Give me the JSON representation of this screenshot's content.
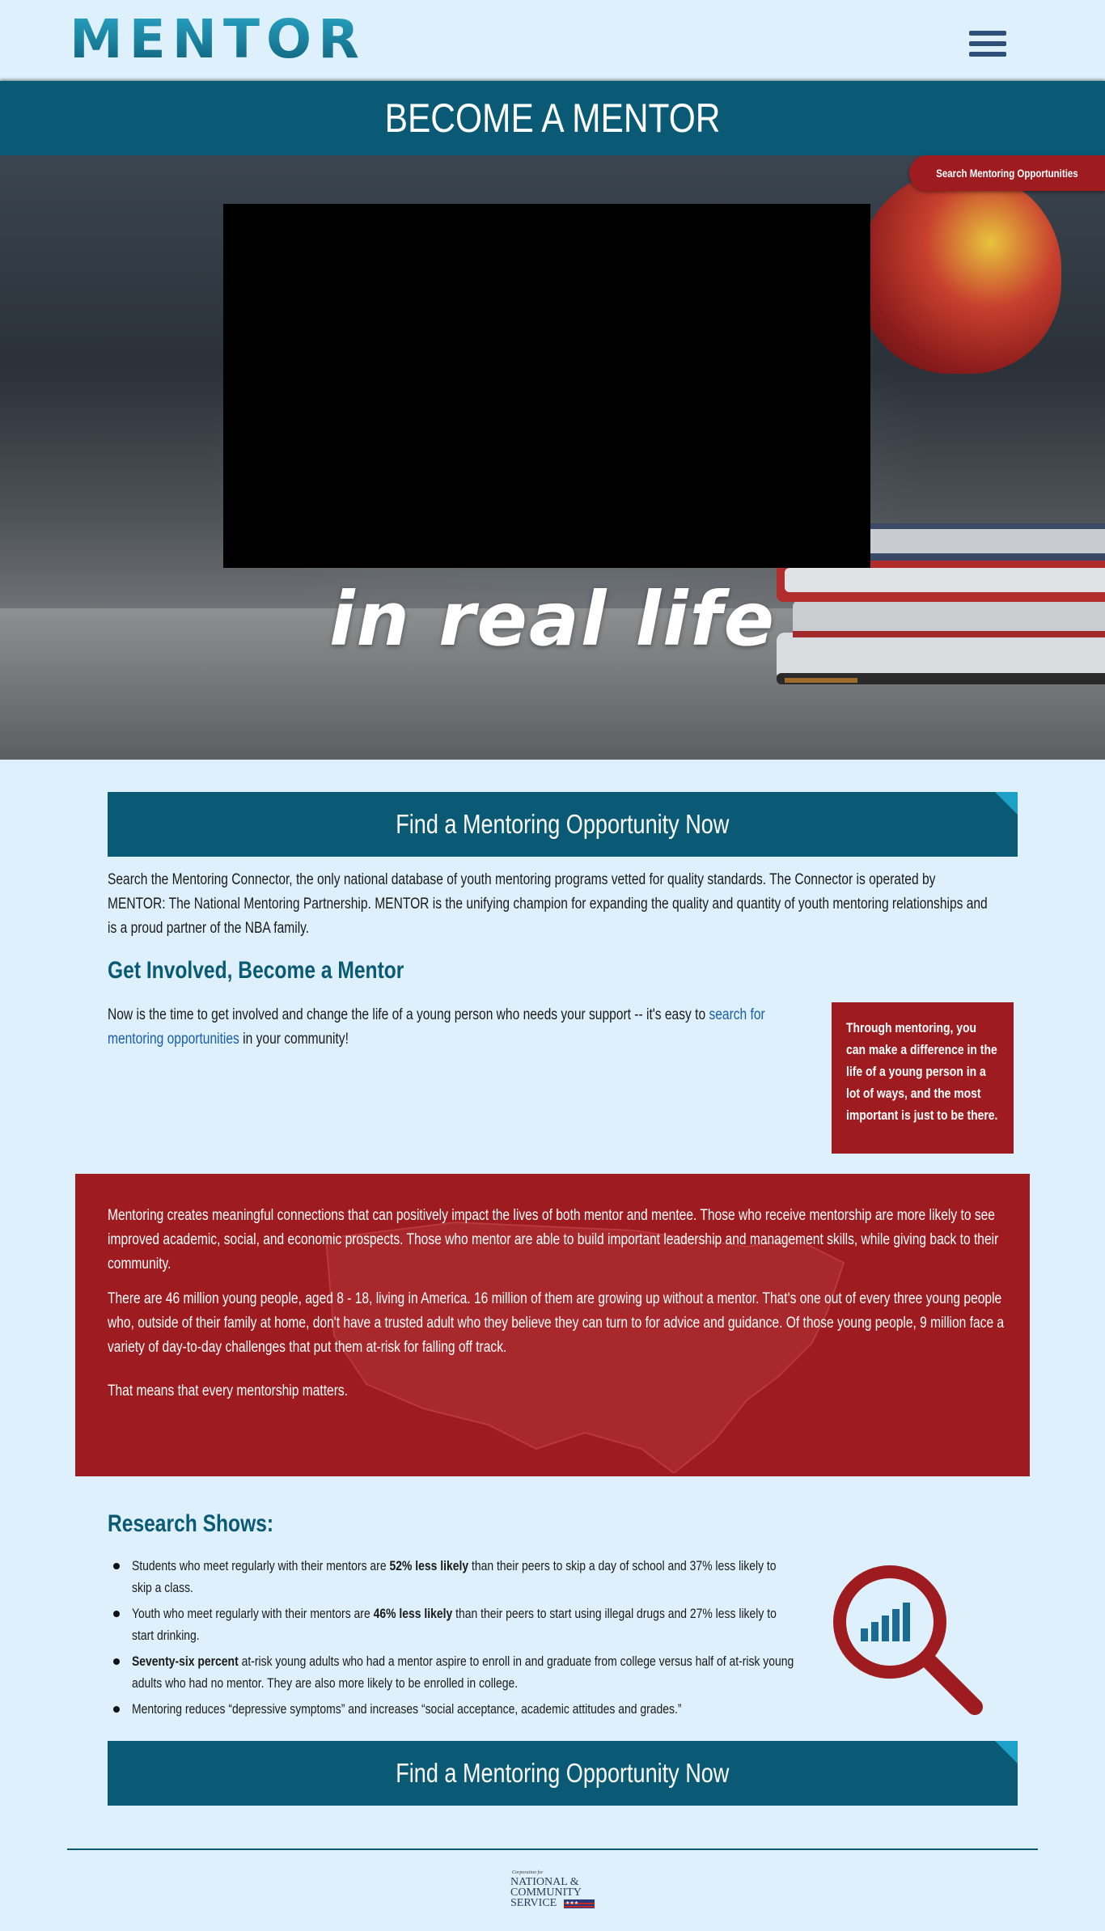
{
  "header": {
    "logo_text": "MENTOR",
    "menu_icon": "hamburger-menu-icon"
  },
  "title_band": {
    "title": "BECOME A MENTOR"
  },
  "hero": {
    "tagline": "in real life",
    "search_tab_label": "Search Mentoring Opportunities"
  },
  "cta": {
    "label": "Find a Mentoring Opportunity Now"
  },
  "intro": {
    "text": "Search the Mentoring Connector, the only national database of youth mentoring programs vetted for quality standards. The Connector is operated by MENTOR: The National Mentoring Partnership. MENTOR is the unifying champion for expanding the quality and quantity of youth mentoring relationships and is a proud partner of the NBA family."
  },
  "get_involved": {
    "heading": "Get Involved, Become a Mentor",
    "text_before": "Now is the time to get involved and change the life of a young person who needs your support -- it's easy to ",
    "link": "search for mentoring opportunities",
    "text_after": " in your community!",
    "quote": "Through mentoring, you can make a difference in the life of a young person in a lot of ways, and the most important is just to be there."
  },
  "red_band": {
    "p1": "Mentoring creates meaningful connections that can positively impact the lives of both mentor and mentee. Those who receive mentorship are more likely to see improved academic, social, and economic prospects. Those who mentor are able to build important leadership and management skills, while giving back to their community.",
    "p2": "There are 46 million young people, aged 8 - 18, living in America. 16 million of them are growing up without a mentor. That's one out of every three young people who, outside of their family at home, don't have a trusted adult who they believe they can turn to for advice and guidance. Of those young people, 9 million face a variety of day-to-day challenges that put them at-risk for falling off track.",
    "p3": "That means that every mentorship matters."
  },
  "research": {
    "heading": "Research Shows:",
    "items": [
      {
        "before": "Students who meet regularly with their mentors are ",
        "bold": "52% less likely",
        "after": " than their peers to skip a day of school and 37% less likely to skip a class."
      },
      {
        "before": "Youth who meet regularly with their mentors are ",
        "bold": "46% less likely",
        "after": " than their peers to start using illegal drugs and 27% less likely to start drinking."
      },
      {
        "before": "",
        "bold": "Seventy-six percent",
        "after": " at-risk young adults who had a mentor aspire to enroll in and graduate from college versus half of at-risk young adults who had no mentor.  They are also more likely to be enrolled in college."
      },
      {
        "before": "Mentoring reduces “depressive symptoms” and increases “social acceptance, academic attitudes and grades.”",
        "bold": "",
        "after": ""
      }
    ]
  },
  "footer": {
    "logo_small": "Corporation for",
    "logo_line1": "NATIONAL &",
    "logo_line2": "COMMUNITY",
    "logo_line3": "SERVICE"
  },
  "colors": {
    "page_bg": "#def0fb",
    "brand_teal": "#0b5a75",
    "accent_red": "#9e1b1f",
    "link_blue": "#1a5dab"
  }
}
